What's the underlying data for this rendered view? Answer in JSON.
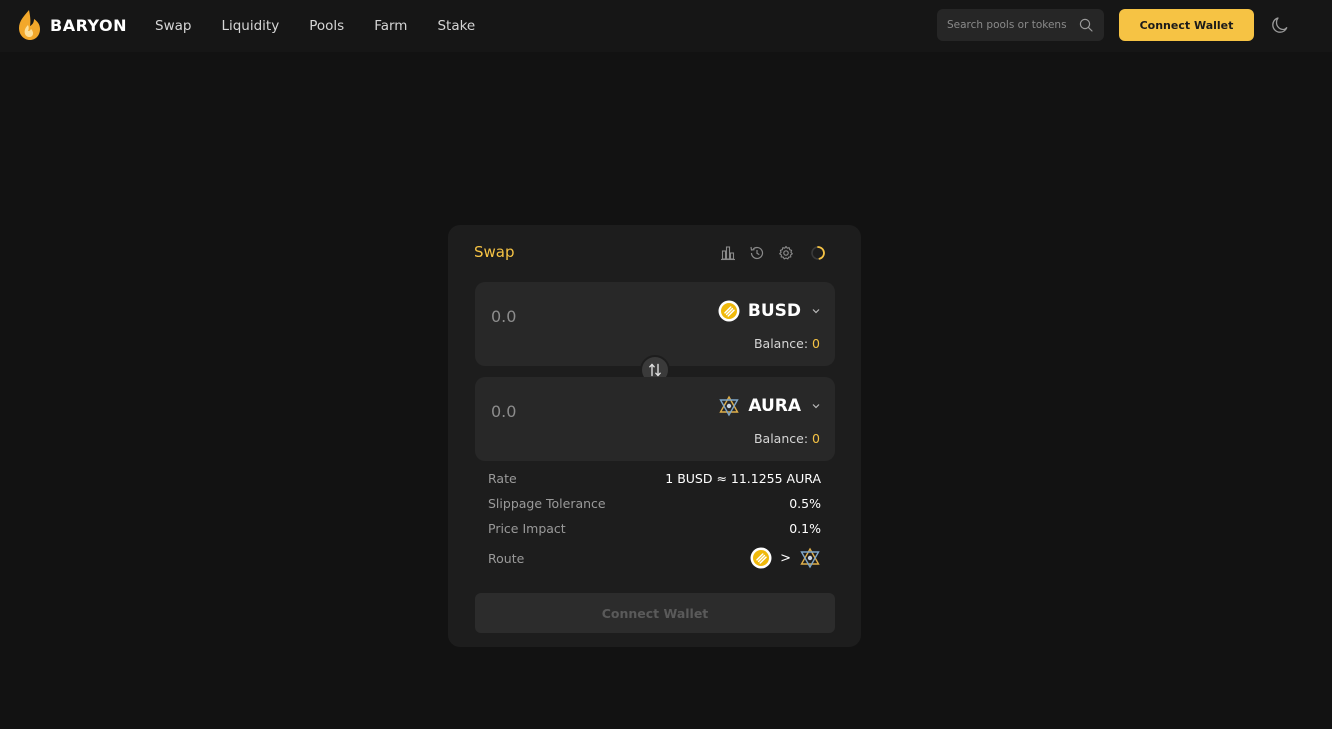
{
  "header": {
    "brand": "BARYON",
    "nav": [
      "Swap",
      "Liquidity",
      "Pools",
      "Farm",
      "Stake"
    ],
    "search_placeholder": "Search pools or tokens",
    "connect_label": "Connect Wallet"
  },
  "swap": {
    "title": "Swap",
    "from": {
      "amount": "0.0",
      "token": "BUSD",
      "balance_label": "Balance:",
      "balance": "0"
    },
    "to": {
      "amount": "0.0",
      "token": "AURA",
      "balance_label": "Balance:",
      "balance": "0"
    },
    "info": [
      {
        "label": "Rate",
        "value": "1 BUSD ≈ 11.1255 AURA"
      },
      {
        "label": "Slippage Tolerance",
        "value": "0.5%"
      },
      {
        "label": "Price Impact",
        "value": "0.1%"
      }
    ],
    "route_label": "Route",
    "route_separator": ">",
    "connect_label": "Connect Wallet"
  },
  "colors": {
    "accent": "#f6c344",
    "background": "#121212",
    "card": "#1d1d1d"
  }
}
